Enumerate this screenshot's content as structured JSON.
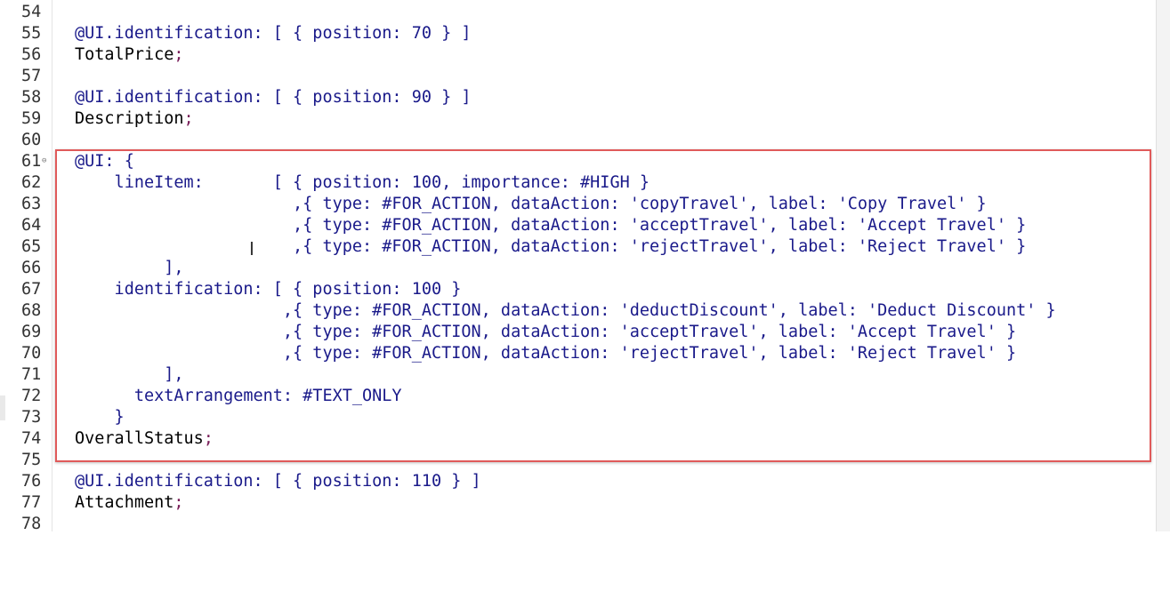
{
  "editor": {
    "lines": [
      {
        "num": "54",
        "text": "",
        "semi": ""
      },
      {
        "num": "55",
        "text": "@UI.identification: [ { position: 70 } ]",
        "semi": ""
      },
      {
        "num": "56",
        "text": "TotalPrice",
        "semi": ";"
      },
      {
        "num": "57",
        "text": "",
        "semi": ""
      },
      {
        "num": "58",
        "text": "@UI.identification: [ { position: 90 } ]",
        "semi": ""
      },
      {
        "num": "59",
        "text": "Description",
        "semi": ";"
      },
      {
        "num": "60",
        "text": "",
        "semi": ""
      },
      {
        "num": "61",
        "text": "@UI: {",
        "semi": "",
        "fold": "⊖"
      },
      {
        "num": "62",
        "text": "    lineItem:       [ { position: 100, importance: #HIGH }",
        "semi": ""
      },
      {
        "num": "63",
        "text": "                      ,{ type: #FOR_ACTION, dataAction: 'copyTravel', label: 'Copy Travel' }",
        "semi": ""
      },
      {
        "num": "64",
        "text": "                      ,{ type: #FOR_ACTION, dataAction: 'acceptTravel', label: 'Accept Travel' }",
        "semi": ""
      },
      {
        "num": "65",
        "text": "                      ,{ type: #FOR_ACTION, dataAction: 'rejectTravel', label: 'Reject Travel' }",
        "semi": ""
      },
      {
        "num": "66",
        "text": "         ],",
        "semi": ""
      },
      {
        "num": "67",
        "text": "    identification: [ { position: 100 }",
        "semi": ""
      },
      {
        "num": "68",
        "text": "                     ,{ type: #FOR_ACTION, dataAction: 'deductDiscount', label: 'Deduct Discount' }",
        "semi": ""
      },
      {
        "num": "69",
        "text": "                     ,{ type: #FOR_ACTION, dataAction: 'acceptTravel', label: 'Accept Travel' }",
        "semi": ""
      },
      {
        "num": "70",
        "text": "                     ,{ type: #FOR_ACTION, dataAction: 'rejectTravel', label: 'Reject Travel' }",
        "semi": ""
      },
      {
        "num": "71",
        "text": "         ],",
        "semi": ""
      },
      {
        "num": "72",
        "text": "      textArrangement: #TEXT_ONLY",
        "semi": ""
      },
      {
        "num": "73",
        "text": "    }",
        "semi": ""
      },
      {
        "num": "74",
        "text": "OverallStatus",
        "semi": ";"
      },
      {
        "num": "75",
        "text": "",
        "semi": ""
      },
      {
        "num": "76",
        "text": "@UI.identification: [ { position: 110 } ]",
        "semi": ""
      },
      {
        "num": "77",
        "text": "Attachment",
        "semi": ";"
      },
      {
        "num": "78",
        "text": "",
        "semi": ""
      }
    ],
    "highlight_color": "#e05a5a",
    "keyword_color": "#1a1a8a",
    "semicolon_color": "#7a1f5a"
  }
}
